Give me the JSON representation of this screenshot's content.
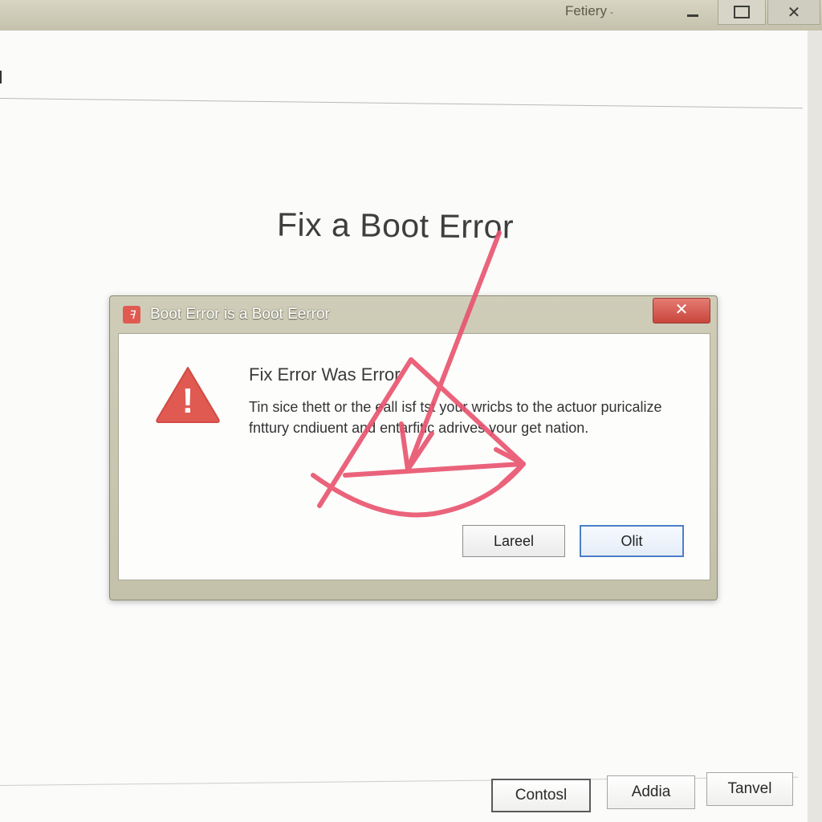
{
  "window": {
    "title": "Fetiery",
    "caret": "-",
    "close_glyph": "✕"
  },
  "page": {
    "title": "Fix a Boot Error"
  },
  "dialog": {
    "app_icon_glyph": "ꟻ",
    "title": "Boot Error is a Boot Eerror",
    "close_glyph": "✕",
    "warning_glyph": "!",
    "heading": "Fix Error Was Error",
    "message": "Tin sice thett or the eall isf tst your wricbs to the actuor puricalize fnttury cndiuent and entarfitic adrives your get nation.",
    "cancel_label": "Lareel",
    "ok_label": "Olit"
  },
  "footer": {
    "buttons": [
      "Contosl",
      "Addia",
      "Tanvel"
    ]
  },
  "colors": {
    "accent_red": "#e05a52",
    "annotation_pink": "#e8536e",
    "ok_border": "#4b7fc9"
  }
}
